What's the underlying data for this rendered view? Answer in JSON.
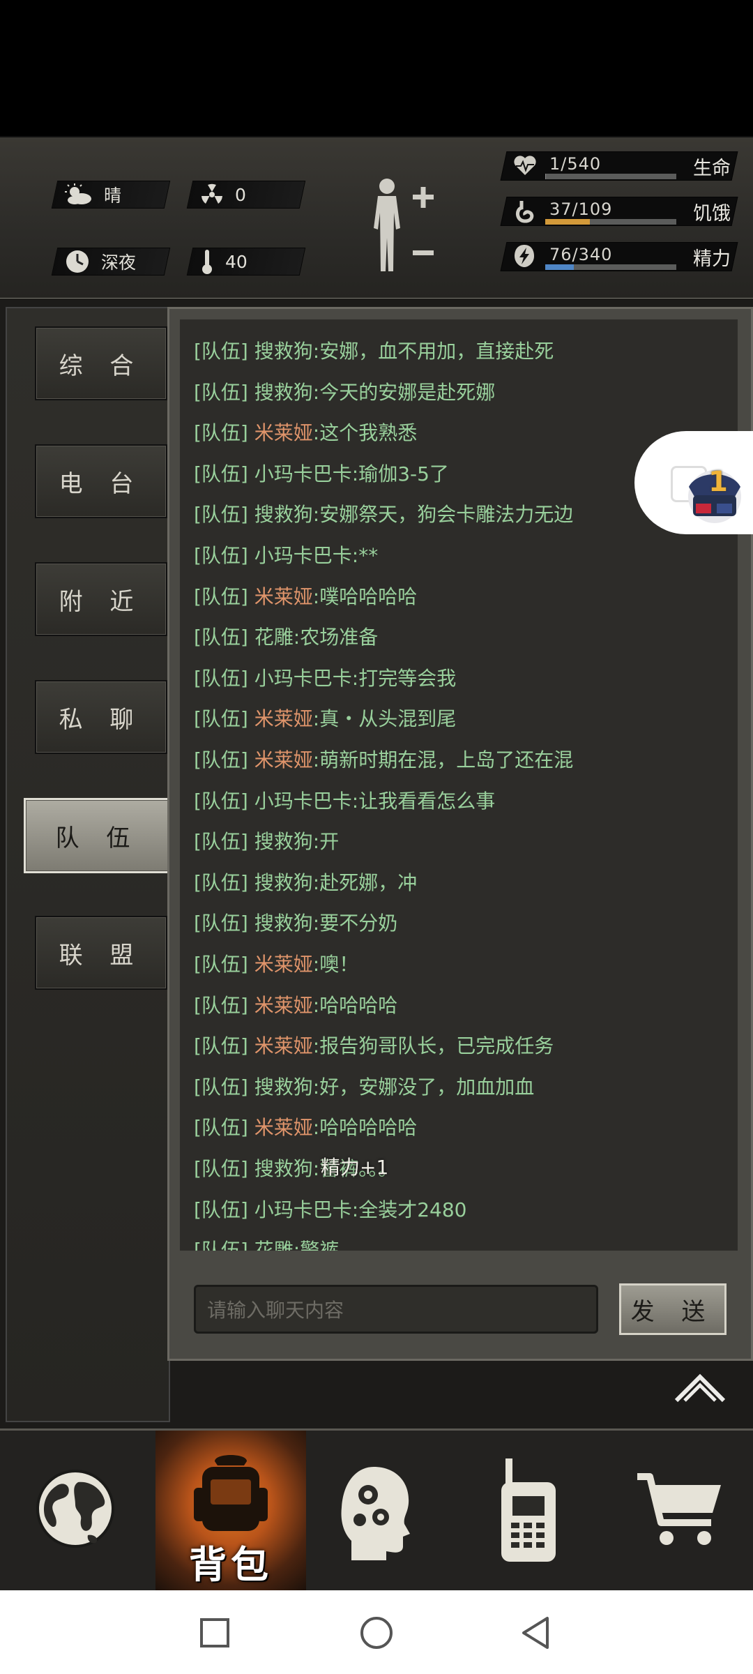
{
  "status": {
    "weather": "晴",
    "radiation": "0",
    "time_of_day": "深夜",
    "temperature": "40"
  },
  "vitals": [
    {
      "label": "生命",
      "value": "1/540",
      "fill": 0.002,
      "color": "#8a8a8a"
    },
    {
      "label": "饥饿",
      "value": "37/109",
      "fill": 0.34,
      "color": "#d39a3a"
    },
    {
      "label": "精力",
      "value": "76/340",
      "fill": 0.22,
      "color": "#4f86c6"
    }
  ],
  "tabs": [
    "综 合",
    "电 台",
    "附 近",
    "私 聊",
    "队 伍",
    "联 盟"
  ],
  "active_tab": "队 伍",
  "messages": [
    {
      "channel": "[队伍]",
      "sender": "搜救狗",
      "text": ":安娜，血不用加，直接赴死",
      "highlight": false
    },
    {
      "channel": "[队伍]",
      "sender": "搜救狗",
      "text": ":今天的安娜是赴死娜",
      "highlight": false
    },
    {
      "channel": "[队伍]",
      "sender": "米莱娅",
      "text": ":这个我熟悉",
      "highlight": true
    },
    {
      "channel": "[队伍]",
      "sender": "小玛卡巴卡",
      "text": ":瑜伽3-5了",
      "highlight": false
    },
    {
      "channel": "[队伍]",
      "sender": "搜救狗",
      "text": ":安娜祭天，狗会卡雕法力无边",
      "highlight": false
    },
    {
      "channel": "[队伍]",
      "sender": "小玛卡巴卡",
      "text": ":**",
      "highlight": false
    },
    {
      "channel": "[队伍]",
      "sender": "米莱娅",
      "text": ":噗哈哈哈哈",
      "highlight": true
    },
    {
      "channel": "[队伍]",
      "sender": "花雕",
      "text": ":农场准备",
      "highlight": false
    },
    {
      "channel": "[队伍]",
      "sender": "小玛卡巴卡",
      "text": ":打完等会我",
      "highlight": false
    },
    {
      "channel": "[队伍]",
      "sender": "米莱娅",
      "text": ":真・从头混到尾",
      "highlight": true
    },
    {
      "channel": "[队伍]",
      "sender": "米莱娅",
      "text": ":萌新时期在混，上岛了还在混",
      "highlight": true
    },
    {
      "channel": "[队伍]",
      "sender": "小玛卡巴卡",
      "text": ":让我看看怎么事",
      "highlight": false
    },
    {
      "channel": "[队伍]",
      "sender": "搜救狗",
      "text": ":开",
      "highlight": false
    },
    {
      "channel": "[队伍]",
      "sender": "搜救狗",
      "text": ":赴死娜，冲",
      "highlight": false
    },
    {
      "channel": "[队伍]",
      "sender": "搜救狗",
      "text": ":要不分奶",
      "highlight": false
    },
    {
      "channel": "[队伍]",
      "sender": "米莱娅",
      "text": ":噢！",
      "highlight": true
    },
    {
      "channel": "[队伍]",
      "sender": "米莱娅",
      "text": ":哈哈哈哈",
      "highlight": true
    },
    {
      "channel": "[队伍]",
      "sender": "米莱娅",
      "text": ":报告狗哥队长，已完成任务",
      "highlight": true
    },
    {
      "channel": "[队伍]",
      "sender": "搜救狗",
      "text": ":好，安娜没了，加血加血",
      "highlight": false
    },
    {
      "channel": "[队伍]",
      "sender": "米莱娅",
      "text": ":哈哈哈哈哈",
      "highlight": true
    },
    {
      "channel": "[队伍]",
      "sender": "搜救狗",
      "text": ":警裤。。。",
      "highlight": false
    },
    {
      "channel": "[队伍]",
      "sender": "小玛卡巴卡",
      "text": ":全装才2480",
      "highlight": false
    },
    {
      "channel": "[队伍]",
      "sender": "花雕",
      "text": ":警裤",
      "highlight": false
    }
  ],
  "float_text": "精力+1",
  "input_placeholder": "请输入聊天内容",
  "send_label": "发 送",
  "badge_count": "1",
  "bottom_nav": {
    "active_label": "背包"
  }
}
